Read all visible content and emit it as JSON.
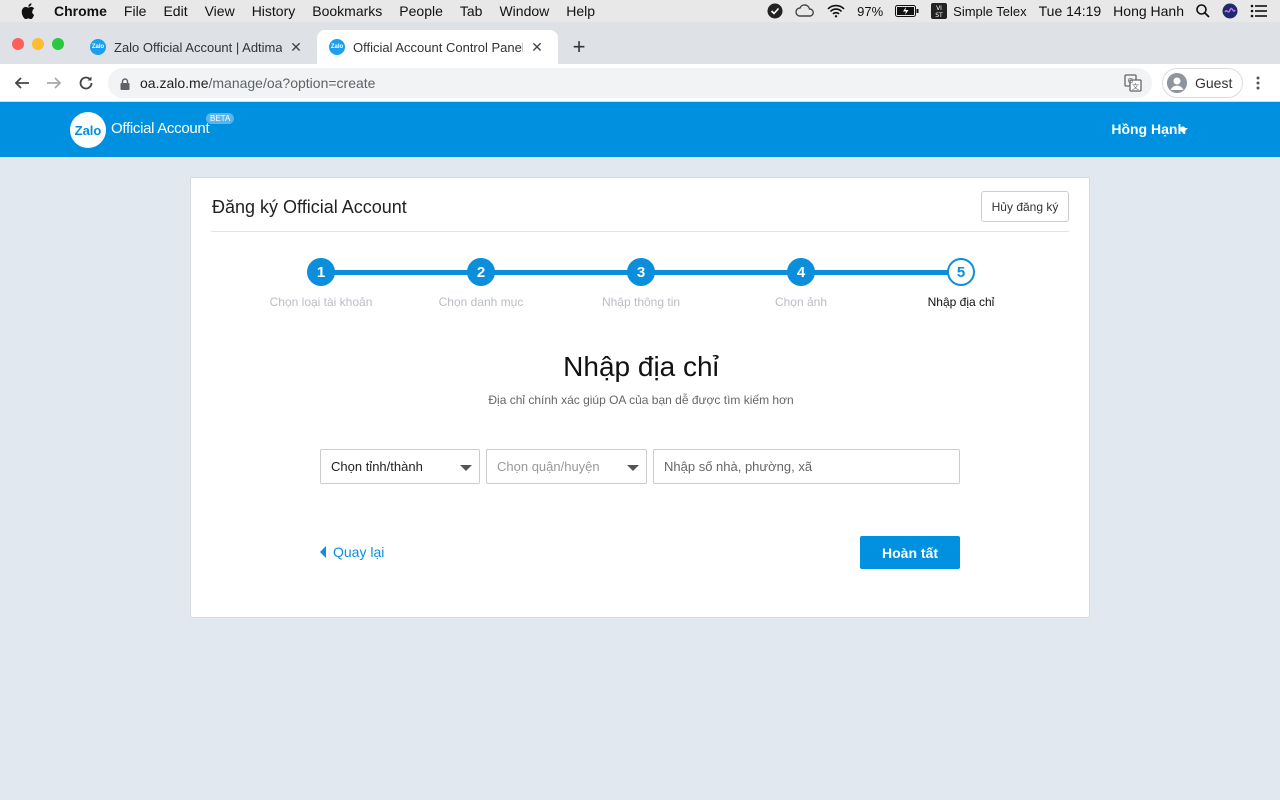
{
  "menubar": {
    "app": "Chrome",
    "items": [
      "File",
      "Edit",
      "View",
      "History",
      "Bookmarks",
      "People",
      "Tab",
      "Window",
      "Help"
    ],
    "battery": "97%",
    "input_method": "Simple Telex",
    "clock": "Tue 14:19",
    "user": "Hong Hanh"
  },
  "tabs": [
    {
      "title": "Zalo Official Account | Adtima",
      "favicon": "Zalo"
    },
    {
      "title": "Official Account Control Panel",
      "favicon": "Zalo"
    }
  ],
  "address": {
    "host": "oa.zalo.me",
    "path": "/manage/oa?option=create"
  },
  "profile": {
    "label": "Guest"
  },
  "header": {
    "logo": "Zalo",
    "title": "Official Account",
    "badge": "BETA",
    "user": "Hồng Hạnh"
  },
  "card": {
    "title": "Đăng ký Official Account",
    "cancel_label": "Hủy đăng ký",
    "steps": [
      {
        "num": "1",
        "label": "Chọn loại tài khoản"
      },
      {
        "num": "2",
        "label": "Chọn danh mục"
      },
      {
        "num": "3",
        "label": "Nhập thông tin"
      },
      {
        "num": "4",
        "label": "Chọn ảnh"
      },
      {
        "num": "5",
        "label": "Nhập địa chỉ"
      }
    ],
    "heading": "Nhập địa chỉ",
    "subheading": "Địa chỉ chính xác giúp OA của bạn dễ được tìm kiếm hơn",
    "province_value": "Chọn tỉnh/thành",
    "district_placeholder": "Chọn quận/huyện",
    "street_placeholder": "Nhập số nhà, phường, xã",
    "back_label": "Quay lại",
    "finish_label": "Hoàn tất"
  },
  "colors": {
    "brand": "#0090e0",
    "step_active": "#0b8fdc",
    "background": "#e2e8ef"
  }
}
